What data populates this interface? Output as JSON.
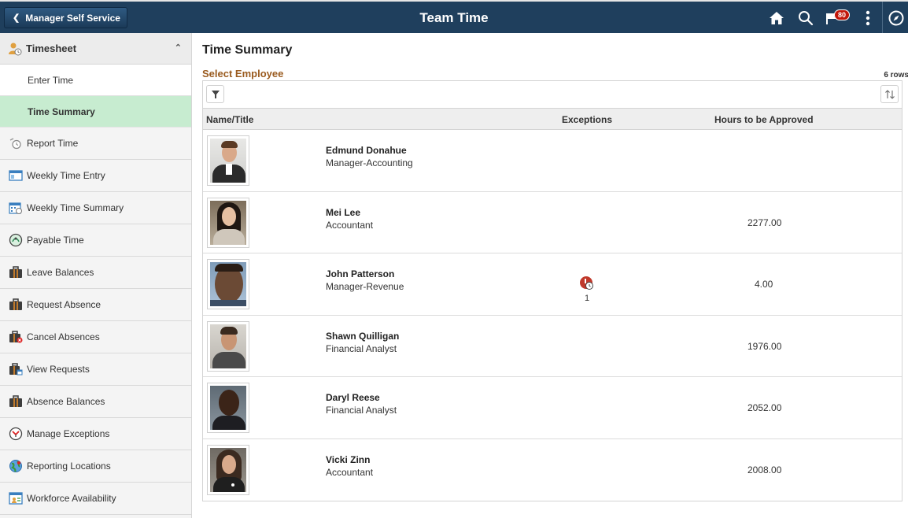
{
  "header": {
    "back_label": "Manager Self Service",
    "title": "Team Time",
    "notification_count": "80"
  },
  "sidebar": {
    "group_label": "Timesheet",
    "subitems": [
      {
        "label": "Enter Time"
      },
      {
        "label": "Time Summary"
      }
    ],
    "items": [
      {
        "label": "Report Time",
        "icon": "clock-icon"
      },
      {
        "label": "Weekly Time Entry",
        "icon": "window-icon"
      },
      {
        "label": "Weekly Time Summary",
        "icon": "calendar-icon"
      },
      {
        "label": "Payable Time",
        "icon": "payable-icon"
      },
      {
        "label": "Leave Balances",
        "icon": "briefcase-icon"
      },
      {
        "label": "Request Absence",
        "icon": "briefcase-icon"
      },
      {
        "label": "Cancel Absences",
        "icon": "briefcase-cancel-icon"
      },
      {
        "label": "View Requests",
        "icon": "briefcase-calendar-icon"
      },
      {
        "label": "Absence Balances",
        "icon": "briefcase-icon"
      },
      {
        "label": "Manage Exceptions",
        "icon": "exceptions-icon"
      },
      {
        "label": "Reporting Locations",
        "icon": "globe-icon"
      },
      {
        "label": "Workforce Availability",
        "icon": "availability-icon"
      }
    ]
  },
  "main": {
    "page_title": "Time Summary",
    "section_title": "Select Employee",
    "row_count": "6 rows",
    "columns": {
      "name": "Name/Title",
      "exceptions": "Exceptions",
      "hours": "Hours to be Approved"
    },
    "rows": [
      {
        "name": "Edmund Donahue",
        "title": "Manager-Accounting",
        "exceptions": "",
        "hours": ""
      },
      {
        "name": "Mei Lee",
        "title": "Accountant",
        "exceptions": "",
        "hours": "2277.00"
      },
      {
        "name": "John Patterson",
        "title": "Manager-Revenue",
        "exceptions": "1",
        "hours": "4.00"
      },
      {
        "name": "Shawn Quilligan",
        "title": "Financial Analyst",
        "exceptions": "",
        "hours": "1976.00"
      },
      {
        "name": "Daryl Reese",
        "title": "Financial Analyst",
        "exceptions": "",
        "hours": "2052.00"
      },
      {
        "name": "Vicki Zinn",
        "title": "Accountant",
        "exceptions": "",
        "hours": "2008.00"
      }
    ]
  },
  "colors": {
    "header_bg": "#1f3f5d",
    "active_item_bg": "#c7ecd0",
    "section_title": "#9a5b1f",
    "badge": "#c2160a"
  }
}
